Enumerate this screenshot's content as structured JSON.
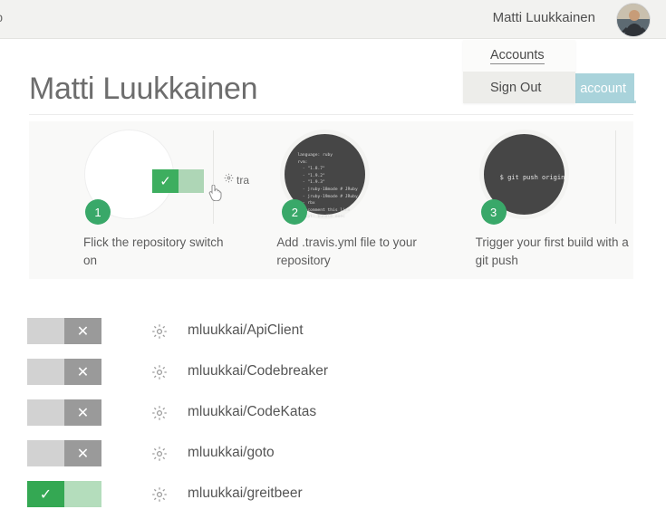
{
  "topbar": {
    "left_label": "lp",
    "user_name": "Matti Luukkainen",
    "avatar_name": "user-avatar"
  },
  "dropdown": {
    "items": [
      {
        "label": "Accounts",
        "state": "normal"
      },
      {
        "label": "Sign Out",
        "state": "highlighted"
      }
    ]
  },
  "sync_button": {
    "label": "account"
  },
  "page": {
    "title": "Matti Luukkainen"
  },
  "onboarding": {
    "steps": [
      {
        "number": "1",
        "caption": "Flick the repository switch on",
        "bubble_kind": "toggle",
        "toggle_label": "tra",
        "check_glyph": "✓"
      },
      {
        "number": "2",
        "caption": "Add .travis.yml file to your repository",
        "bubble_kind": "code",
        "code": "language: ruby\nrvm:\n  - \"1.8.7\"\n  - \"1.9.2\"\n  - \"1.9.3\"\n  - jruby-18mode # JRuby\n  - jruby-19mode # JRuby\n  - rbx\n# uncomment this line\nscript: bundle exec"
      },
      {
        "number": "3",
        "caption": "Trigger your first build with a git push",
        "bubble_kind": "terminal",
        "terminal": "$ git push origin"
      }
    ]
  },
  "repositories": {
    "rows": [
      {
        "name": "mluukkai/ApiClient",
        "enabled": false,
        "glyph": "✕"
      },
      {
        "name": "mluukkai/Codebreaker",
        "enabled": false,
        "glyph": "✕"
      },
      {
        "name": "mluukkai/CodeKatas",
        "enabled": false,
        "glyph": "✕"
      },
      {
        "name": "mluukkai/goto",
        "enabled": false,
        "glyph": "✕"
      },
      {
        "name": "mluukkai/greitbeer",
        "enabled": true,
        "glyph": "✓"
      }
    ]
  },
  "colors": {
    "green": "#34a853",
    "green_badge": "#39a869",
    "teal": "#a9d3db",
    "toggle_off": "#d2d2d2",
    "dark_bubble": "#464646"
  }
}
